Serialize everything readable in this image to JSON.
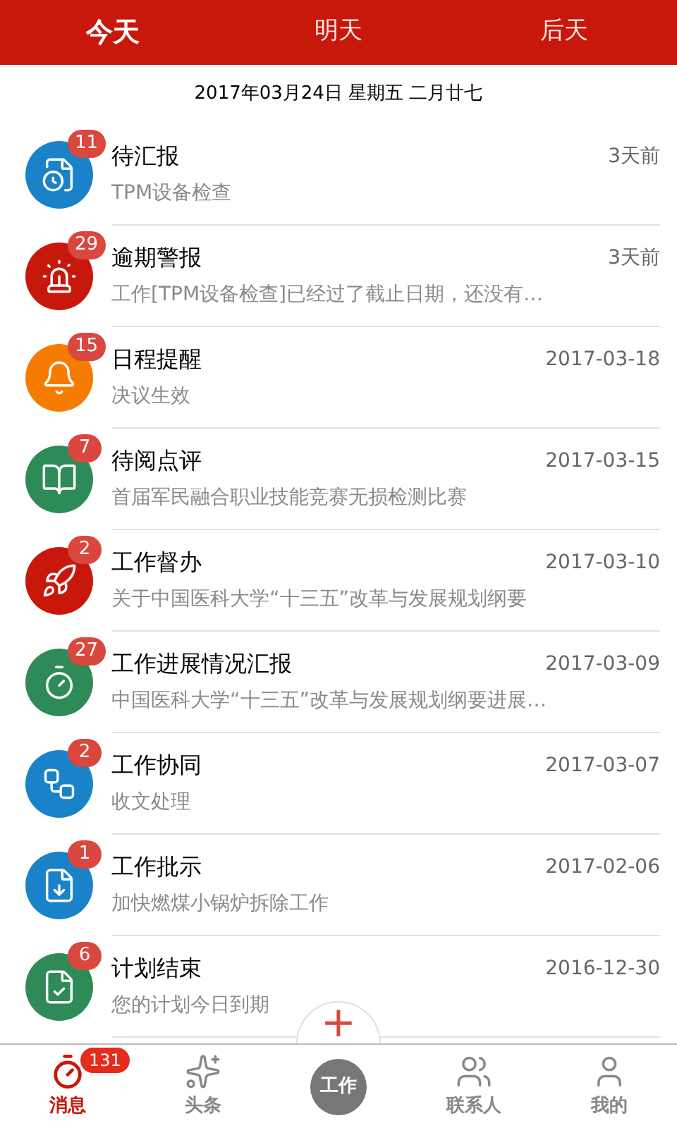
{
  "day_tabs": [
    {
      "label": "今天",
      "selected": true
    },
    {
      "label": "明天",
      "selected": false
    },
    {
      "label": "后天",
      "selected": false
    }
  ],
  "date_line": "2017年03月24日 星期五 二月廿七",
  "messages": [
    {
      "title": "待汇报",
      "subtitle": "TPM设备检查",
      "time": "3天前",
      "badge": "11",
      "color": "#1a82c8"
    },
    {
      "title": "逾期警报",
      "subtitle": "工作[TPM设备检查]已经过了截止日期，还没有…",
      "time": "3天前",
      "badge": "29",
      "color": "#c8180c"
    },
    {
      "title": "日程提醒",
      "subtitle": "决议生效",
      "time": "2017-03-18",
      "badge": "15",
      "color": "#f57c00"
    },
    {
      "title": "待阅点评",
      "subtitle": "首届军民融合职业技能竞赛无损检测比赛",
      "time": "2017-03-15",
      "badge": "7",
      "color": "#2e8b57"
    },
    {
      "title": "工作督办",
      "subtitle": "关于中国医科大学“十三五”改革与发展规划纲要",
      "time": "2017-03-10",
      "badge": "2",
      "color": "#c8180c"
    },
    {
      "title": "工作进展情况汇报",
      "subtitle": "中国医科大学“十三五”改革与发展规划纲要进展…",
      "time": "2017-03-09",
      "badge": "27",
      "color": "#2e8b57"
    },
    {
      "title": "工作协同",
      "subtitle": "收文处理",
      "time": "2017-03-07",
      "badge": "2",
      "color": "#1a82c8"
    },
    {
      "title": "工作批示",
      "subtitle": "加快燃煤小锅炉拆除工作",
      "time": "2017-02-06",
      "badge": "1",
      "color": "#1a82c8"
    },
    {
      "title": "计划结束",
      "subtitle": "您的计划今日到期",
      "time": "2016-12-30",
      "badge": "6",
      "color": "#2e8b57"
    }
  ],
  "add_button": "+",
  "bottom_tabs": [
    {
      "label": "消息",
      "selected": true,
      "badge": "131"
    },
    {
      "label": "头条",
      "selected": false
    },
    {
      "label": "工作",
      "selected": false,
      "kind": "center"
    },
    {
      "label": "联系人",
      "selected": false
    },
    {
      "label": "我的",
      "selected": false
    }
  ]
}
